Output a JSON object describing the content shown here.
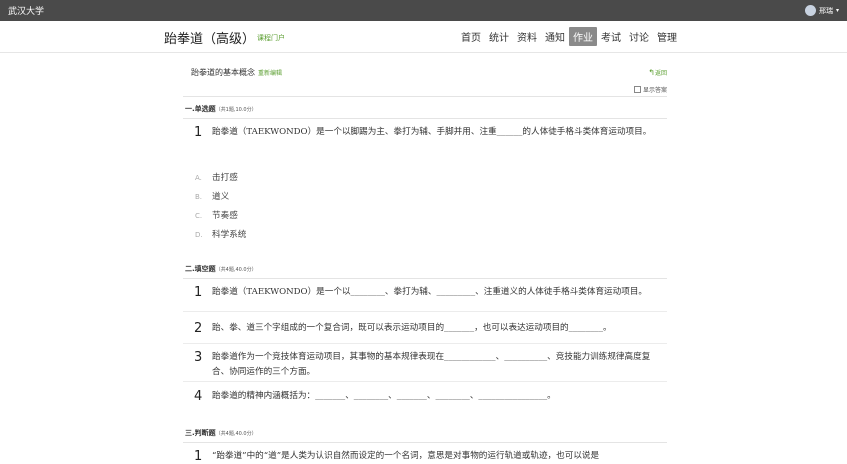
{
  "topbar": {
    "brand": "武汉大学",
    "user": "邢瑞"
  },
  "course": {
    "title": "跆拳道（高级）",
    "portal": "课程门户"
  },
  "nav": [
    "首页",
    "统计",
    "资料",
    "通知",
    "作业",
    "考试",
    "讨论",
    "管理"
  ],
  "nav_active": "作业",
  "page": {
    "title": "跆拳道的基本概念",
    "retake": "重新编辑",
    "back": "返回",
    "show_answer": "显示答案"
  },
  "sections": [
    {
      "title": "一.单选题",
      "meta": "（共1题,10.0分）",
      "questions": [
        {
          "num": "1",
          "text": "跆拳道（TAEKWONDO）是一个以脚踢为主、拳打为辅、手脚并用、注重______的人体徒手格斗类体育运动项目。",
          "options": [
            {
              "letter": "A.",
              "text": "击打感"
            },
            {
              "letter": "B.",
              "text": "道义"
            },
            {
              "letter": "C.",
              "text": "节奏感"
            },
            {
              "letter": "D.",
              "text": "科学系统"
            }
          ]
        }
      ]
    },
    {
      "title": "二.填空题",
      "meta": "（共4题,40.0分）",
      "questions": [
        {
          "num": "1",
          "text": "跆拳道（TAEKWONDO）是一个以________、拳打为辅、_________、注重道义的人体徒手格斗类体育运动项目。"
        },
        {
          "num": "2",
          "text": "跆、拳、道三个字组成的一个复合词，既可以表示运动项目的_______，也可以表达运动项目的________。"
        },
        {
          "num": "3",
          "text": "跆拳道作为一个竞技体育运动项目，其事物的基本规律表现在____________、__________、竞技能力训练规律高度复合、协同运作的三个方面。"
        },
        {
          "num": "4",
          "text": "跆拳道的精神内涵概括为：_______、________、_______、________、________________。"
        }
      ]
    },
    {
      "title": "三.判断题",
      "meta": "（共4题,40.0分）",
      "questions": [
        {
          "num": "1",
          "text": "“跆拳道”中的“道”是人类为认识自然而设定的一个名词，意思是对事物的运行轨道或轨迹，也可以说是"
        }
      ]
    }
  ]
}
